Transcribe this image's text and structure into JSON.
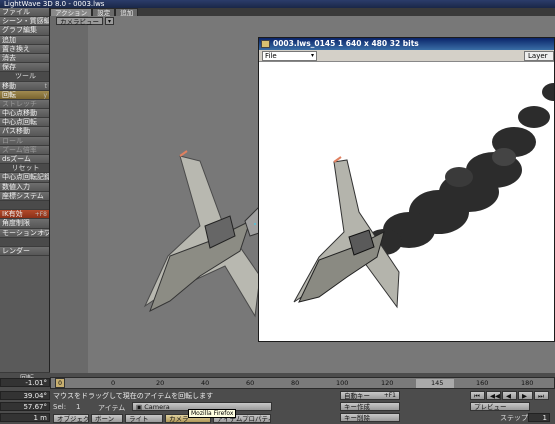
{
  "window": {
    "title": "LightWave 3D 8.0 - 0003.lws"
  },
  "left_panel": {
    "items": [
      {
        "label": "ファイル",
        "shortcut": "",
        "style": "normal"
      },
      {
        "label": "シーン・質感編集",
        "shortcut": "",
        "style": "normal"
      },
      {
        "label": "グラフ編集",
        "shortcut": "",
        "style": "normal"
      },
      {
        "label": "追加",
        "shortcut": "",
        "style": "normal"
      },
      {
        "label": "置き換え",
        "shortcut": "",
        "style": "normal"
      },
      {
        "label": "消去",
        "shortcut": "",
        "style": "normal"
      },
      {
        "label": "保存",
        "shortcut": "",
        "style": "normal"
      },
      {
        "label": "ツール",
        "shortcut": "",
        "style": "header"
      },
      {
        "label": "移動",
        "shortcut": "t",
        "style": "normal"
      },
      {
        "label": "回転",
        "shortcut": "y",
        "style": "hi"
      },
      {
        "label": "ストレッチ",
        "shortcut": "",
        "style": "dim"
      },
      {
        "label": "中心点移動",
        "shortcut": "",
        "style": "normal"
      },
      {
        "label": "中心点回転",
        "shortcut": "",
        "style": "normal"
      },
      {
        "label": "パス移動",
        "shortcut": "",
        "style": "normal"
      },
      {
        "label": "ロール",
        "shortcut": "",
        "style": "dim"
      },
      {
        "label": "ズーム倍率",
        "shortcut": "",
        "style": "dim"
      },
      {
        "label": "dsズーム",
        "shortcut": "",
        "style": "normal"
      },
      {
        "label": "リセット",
        "shortcut": "",
        "style": "header"
      },
      {
        "label": "中心点回転記録",
        "shortcut": "",
        "style": "normal"
      },
      {
        "label": "数値入力",
        "shortcut": "",
        "style": "normal"
      },
      {
        "label": "座標システム",
        "shortcut": "",
        "style": "normal"
      },
      {
        "label": "",
        "shortcut": "",
        "style": "header"
      },
      {
        "label": "IK有効",
        "shortcut": "+F8",
        "style": "red"
      },
      {
        "label": "角度制限",
        "shortcut": "",
        "style": "normal"
      },
      {
        "label": "モーションオプション",
        "shortcut": "m",
        "style": "normal"
      },
      {
        "label": "",
        "shortcut": "",
        "style": "header"
      },
      {
        "label": "レンダー",
        "shortcut": "",
        "style": "normal"
      }
    ]
  },
  "tabs": [
    {
      "label": "アクション",
      "active": true
    },
    {
      "label": "設定",
      "active": false
    },
    {
      "label": "追加",
      "active": false
    }
  ],
  "viewport": {
    "view_mode": "カメラビュー"
  },
  "render_window": {
    "title": "0003.lws_0145 1  640 x 480 32 bits",
    "file_menu": "File",
    "layer_menu": "Layer"
  },
  "timeline": {
    "current_frame": "0",
    "ticks": [
      "0",
      "20",
      "40",
      "60",
      "80",
      "100",
      "120",
      "145",
      "160",
      "180"
    ]
  },
  "bottom": {
    "rotate_label": "回転",
    "val1": "-1.01°",
    "val2": "39.04°",
    "val3": "57.67°",
    "val4": "1 m",
    "message": "マウスをドラッグして現在のアイテムを回転します",
    "sel_label": "Sel:",
    "sel_value": "1",
    "item_label": "アイテム",
    "item_value": "Camera",
    "auto_key": "自動キー",
    "auto_key_shortcut": "+F1",
    "create_key": "キー作成",
    "delete_key": "キー削除",
    "preview": "プレビュー",
    "step_label": "ステップ",
    "step_value": "1",
    "btn_object": "オブジェクト",
    "btn_bone": "ボーン",
    "btn_light": "ライト",
    "btn_camera": "カメラ",
    "btn_props": "アイテムプロパティ",
    "tooltip": "Mozilla Firefox"
  }
}
